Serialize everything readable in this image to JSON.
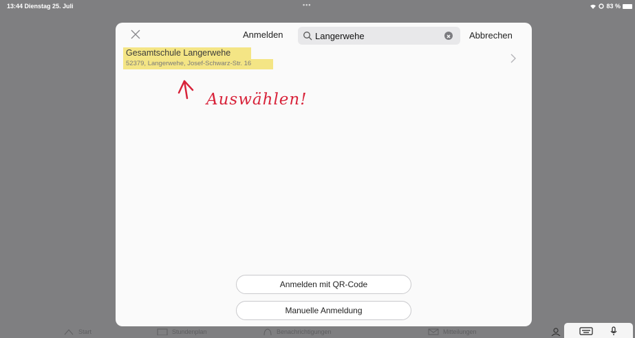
{
  "status": {
    "time_date": "13:44  Dienstag 25. Juli",
    "battery": "83 %"
  },
  "dialog": {
    "title": "Anmelden",
    "search": {
      "value": "Langerwehe",
      "placeholder": ""
    },
    "cancel_label": "Abbrechen",
    "results": [
      {
        "name": "Gesamtschule Langerwehe",
        "address": "52379, Langerwehe, Josef-Schwarz-Str. 16"
      }
    ],
    "annotation": "Auswählen!",
    "qr_button": "Anmelden mit QR-Code",
    "manual_button": "Manuelle Anmeldung"
  },
  "tabbar": {
    "items": [
      {
        "label": "Start",
        "icon": "home-icon"
      },
      {
        "label": "Stundenplan",
        "icon": "calendar-icon"
      },
      {
        "label": "Benachrichtigungen",
        "icon": "bell-icon"
      },
      {
        "label": "Mitteilungen",
        "icon": "mail-icon"
      }
    ]
  },
  "colors": {
    "highlight": "#f3e37b",
    "annotation_red": "#d8233a",
    "backdrop": "#7f7f81"
  }
}
